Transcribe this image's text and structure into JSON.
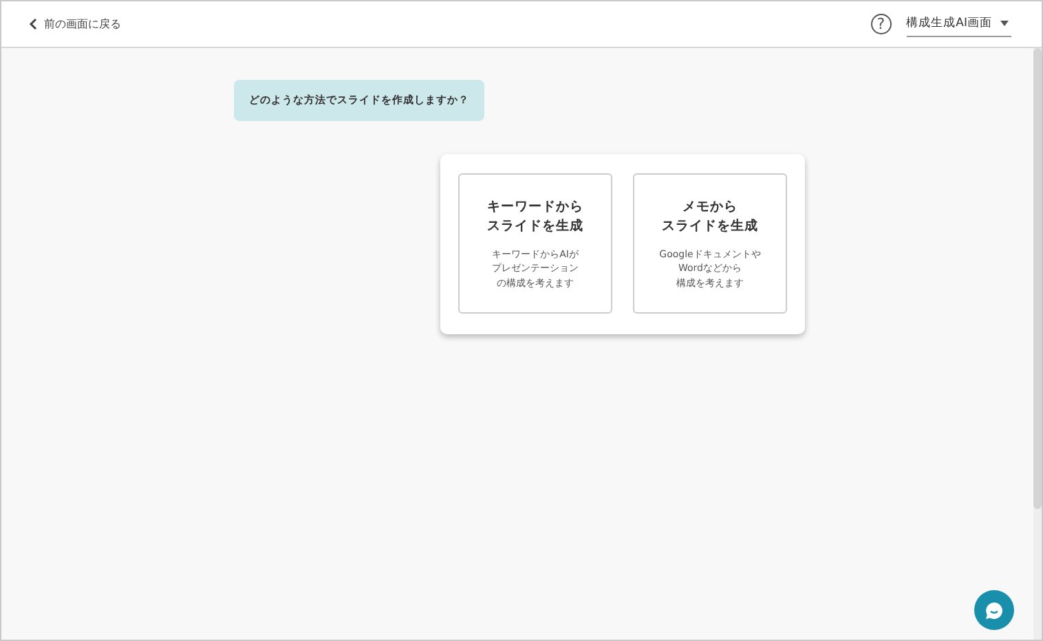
{
  "header": {
    "back_link": "前の画面に戻る",
    "help_icon": "?",
    "mode_select": "構成生成AI画面"
  },
  "question": "どのような方法でスライドを作成しますか？",
  "options": [
    {
      "title_lines": [
        "キーワードから",
        "スライドを生成"
      ],
      "description_lines": [
        "キーワードからAIが",
        "プレゼンテーション",
        "の構成を考えます"
      ]
    },
    {
      "title_lines": [
        "メモから",
        "スライドを生成"
      ],
      "description_lines": [
        "Googleドキュメントや",
        "Wordなどから",
        "構成を考えます"
      ]
    }
  ]
}
